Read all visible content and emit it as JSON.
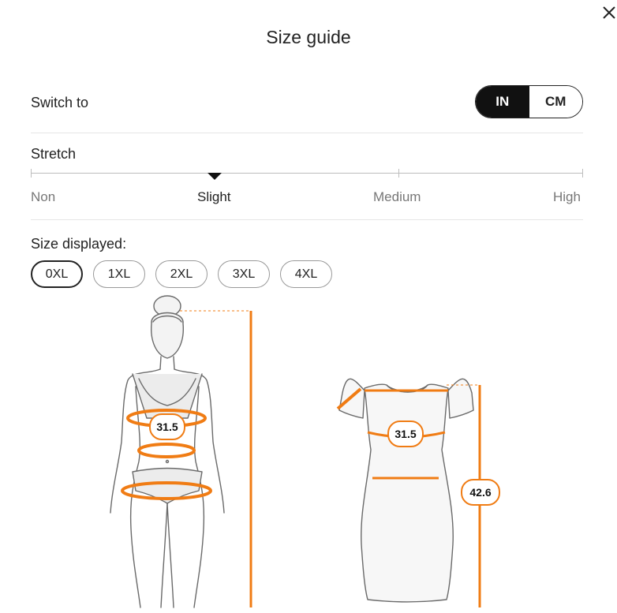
{
  "dialog": {
    "title": "Size guide"
  },
  "units": {
    "label": "Switch to",
    "options": [
      "IN",
      "CM"
    ],
    "selected": "IN"
  },
  "stretch": {
    "label": "Stretch",
    "levels": [
      "Non",
      "Slight",
      "Medium",
      "High"
    ],
    "selected": "Slight"
  },
  "sizes": {
    "label": "Size displayed:",
    "options": [
      "0XL",
      "1XL",
      "2XL",
      "3XL",
      "4XL"
    ],
    "selected": "0XL"
  },
  "measurements": {
    "body_bust": "31.5",
    "dress_bust": "31.5",
    "dress_length": "42.6"
  },
  "colors": {
    "accent": "#f07c14",
    "outline": "#555555",
    "selected_fill": "#111111"
  },
  "icons": {
    "close": "close-icon",
    "stretch_marker": "triangle-down-icon"
  }
}
